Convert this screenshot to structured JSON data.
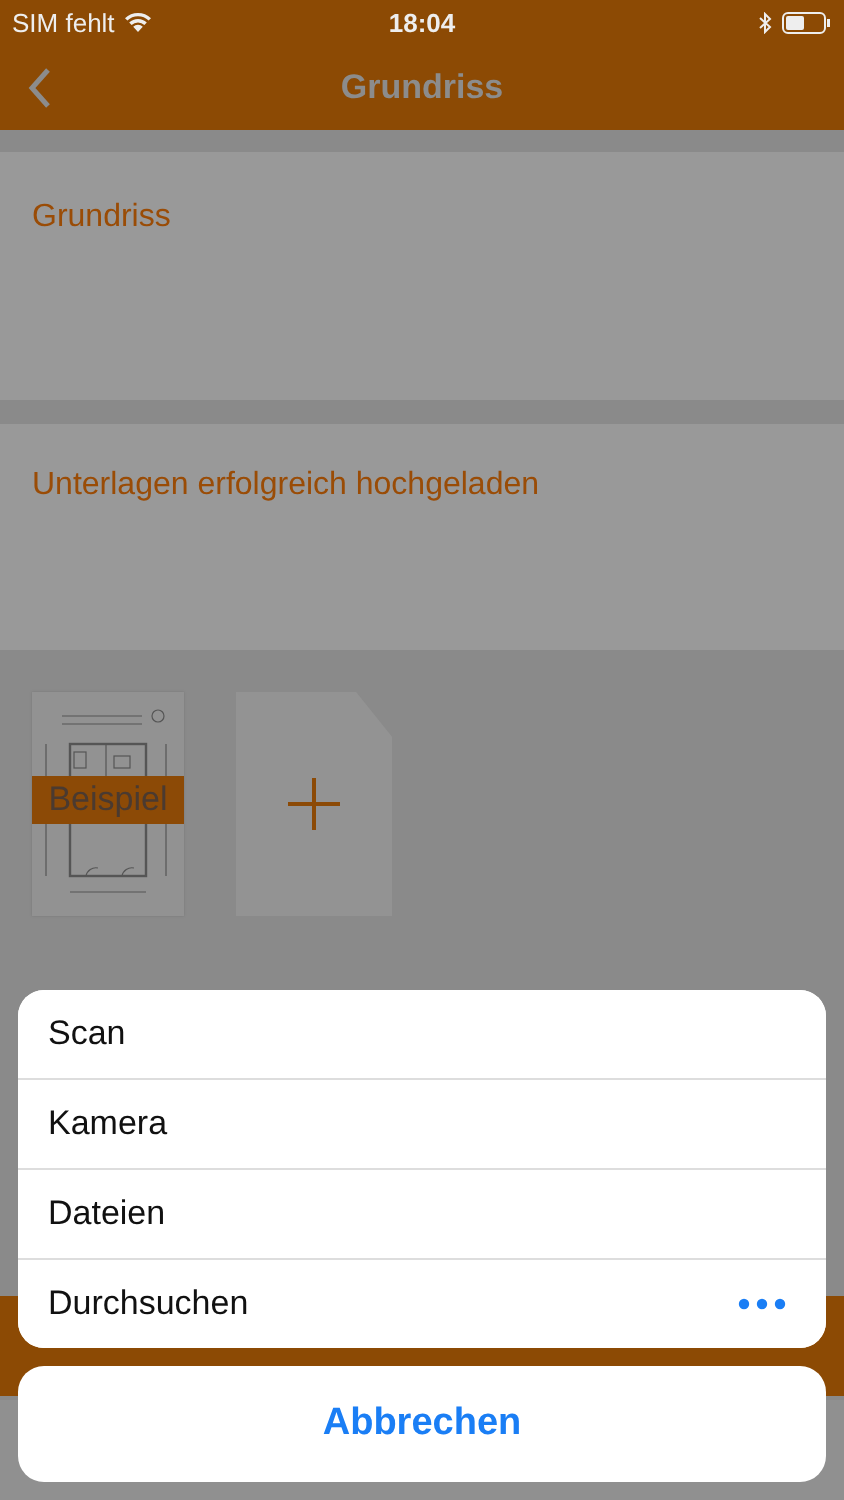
{
  "status_bar": {
    "carrier": "SIM fehlt",
    "time": "18:04"
  },
  "nav": {
    "title": "Grundriss"
  },
  "sections": [
    {
      "title": "Grundriss"
    },
    {
      "title": "Unterlagen erfolgreich hochgeladen"
    }
  ],
  "documents": [
    {
      "kind": "example",
      "label": "Beispiel"
    },
    {
      "kind": "add"
    }
  ],
  "action_sheet": {
    "options": [
      {
        "label": "Scan",
        "more": false
      },
      {
        "label": "Kamera",
        "more": false
      },
      {
        "label": "Dateien",
        "more": false
      },
      {
        "label": "Durchsuchen",
        "more": true
      }
    ],
    "cancel": "Abbrechen"
  }
}
